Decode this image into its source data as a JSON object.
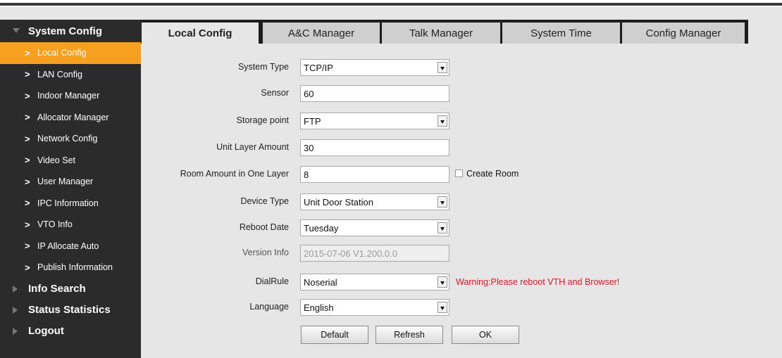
{
  "sidebar": {
    "section_main": "System Config",
    "items": [
      {
        "label": "Local Config",
        "active": true
      },
      {
        "label": "LAN Config"
      },
      {
        "label": "Indoor Manager"
      },
      {
        "label": "Allocator Manager"
      },
      {
        "label": "Network Config"
      },
      {
        "label": "Video Set"
      },
      {
        "label": "User Manager"
      },
      {
        "label": "IPC Information"
      },
      {
        "label": "VTO Info"
      },
      {
        "label": "IP Allocate Auto"
      },
      {
        "label": "Publish Information"
      }
    ],
    "sections": [
      "Info Search",
      "Status Statistics",
      "Logout"
    ]
  },
  "tabs": [
    "Local Config",
    "A&C Manager",
    "Talk Manager",
    "System Time",
    "Config Manager"
  ],
  "form": {
    "system_type": {
      "label": "System Type",
      "value": "TCP/IP"
    },
    "sensor": {
      "label": "Sensor",
      "value": "60"
    },
    "storage_point": {
      "label": "Storage point",
      "value": "FTP"
    },
    "unit_layer_amount": {
      "label": "Unit Layer Amount",
      "value": "30"
    },
    "room_amount": {
      "label": "Room Amount in One Layer",
      "value": "8",
      "create_room_label": "Create Room"
    },
    "device_type": {
      "label": "Device Type",
      "value": "Unit Door Station"
    },
    "reboot_date": {
      "label": "Reboot Date",
      "value": "Tuesday"
    },
    "version_info": {
      "label": "Version Info",
      "value": "2015-07-06 V1.200.0.0"
    },
    "dial_rule": {
      "label": "DialRule",
      "value": "Noserial",
      "warning": "Warning:Please reboot VTH and Browser!"
    },
    "language": {
      "label": "Language",
      "value": "English"
    }
  },
  "buttons": {
    "default": "Default",
    "refresh": "Refresh",
    "ok": "OK"
  },
  "colors": {
    "accent": "#f7a01f",
    "sidebar": "#2b2b2b",
    "warning": "#e0191f"
  }
}
